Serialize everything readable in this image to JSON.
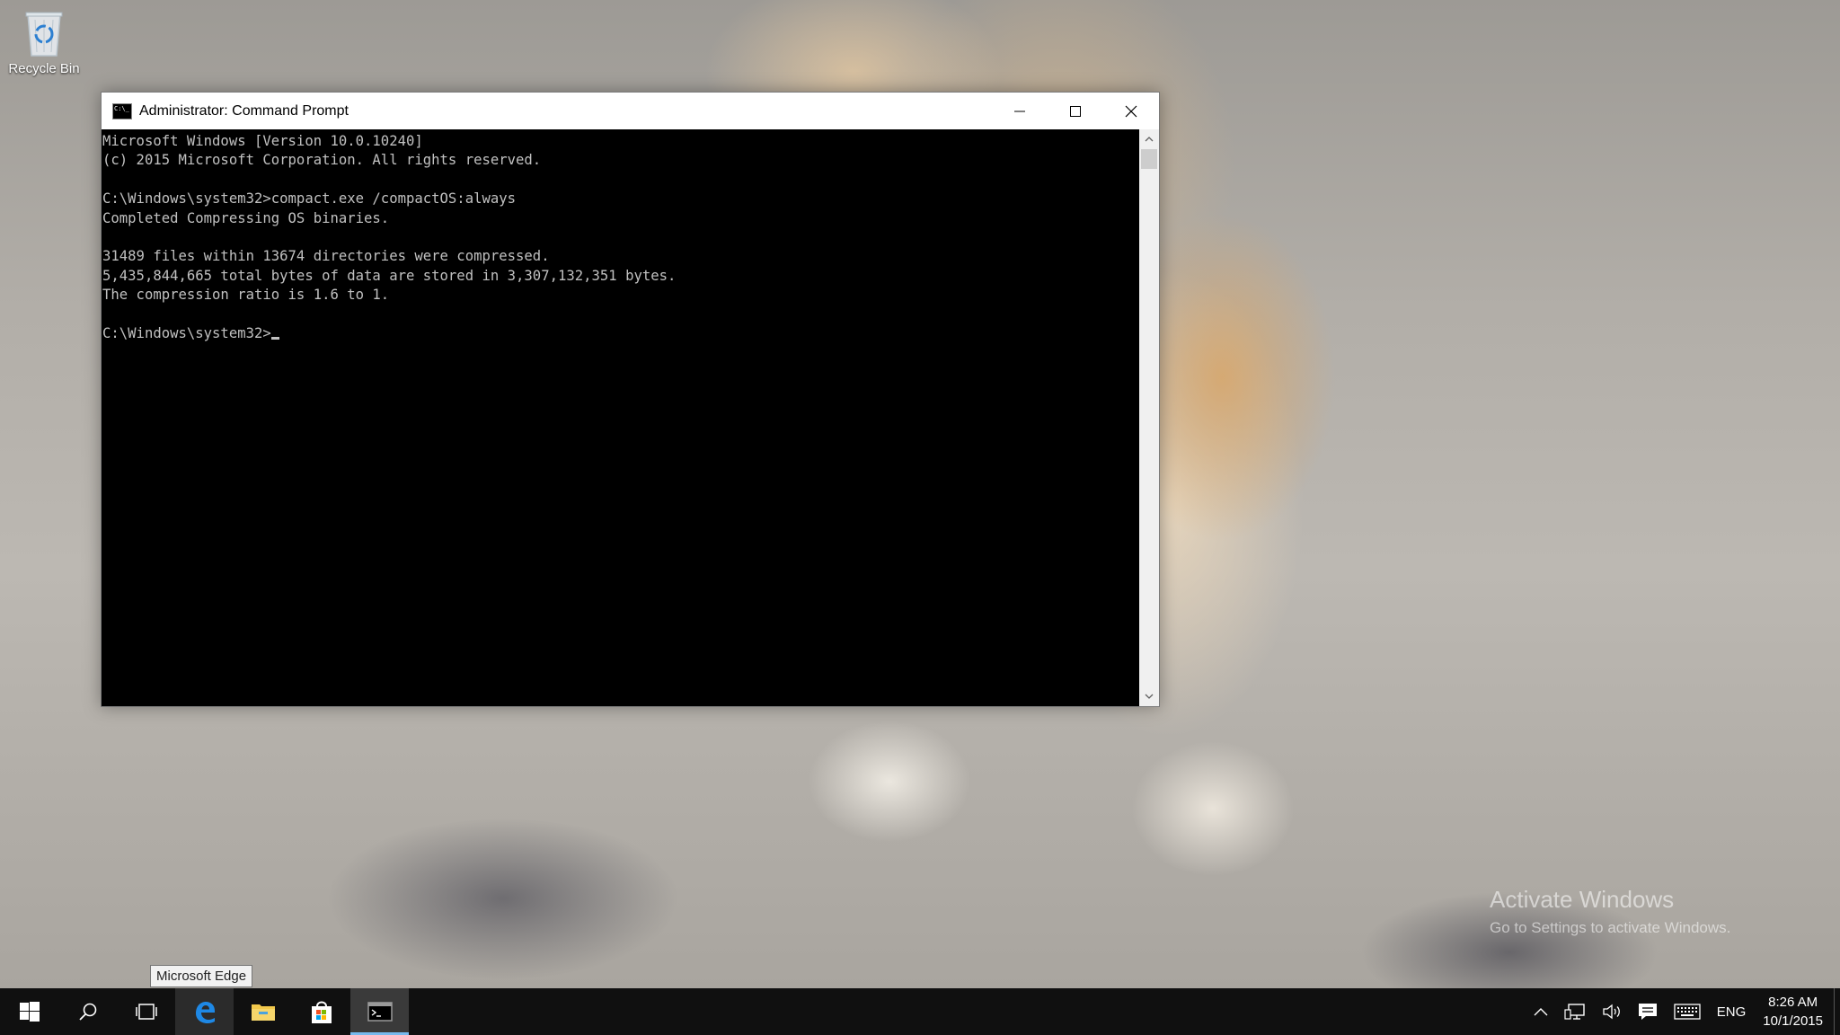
{
  "desktop": {
    "recycle_bin_label": "Recycle Bin"
  },
  "window": {
    "title": "Administrator: Command Prompt",
    "console_lines": [
      "Microsoft Windows [Version 10.0.10240]",
      "(c) 2015 Microsoft Corporation. All rights reserved.",
      "",
      "C:\\Windows\\system32>compact.exe /compactOS:always",
      "Completed Compressing OS binaries.",
      "",
      "31489 files within 13674 directories were compressed.",
      "5,435,844,665 total bytes of data are stored in 3,307,132,351 bytes.",
      "The compression ratio is 1.6 to 1.",
      ""
    ],
    "prompt": "C:\\Windows\\system32>"
  },
  "watermark": {
    "title": "Activate Windows",
    "subtitle": "Go to Settings to activate Windows."
  },
  "tooltip": "Microsoft Edge",
  "taskbar": {
    "items": [
      "start-icon",
      "search-icon",
      "task-view-icon",
      "edge-icon",
      "file-explorer-icon",
      "store-icon",
      "command-prompt-icon"
    ],
    "language": "ENG",
    "time": "8:26 AM",
    "date": "10/1/2015"
  },
  "colors": {
    "taskbar_bg": "#101010",
    "console_bg": "#000000",
    "console_fg": "#c0c0c0",
    "accent": "#76b9ed"
  }
}
